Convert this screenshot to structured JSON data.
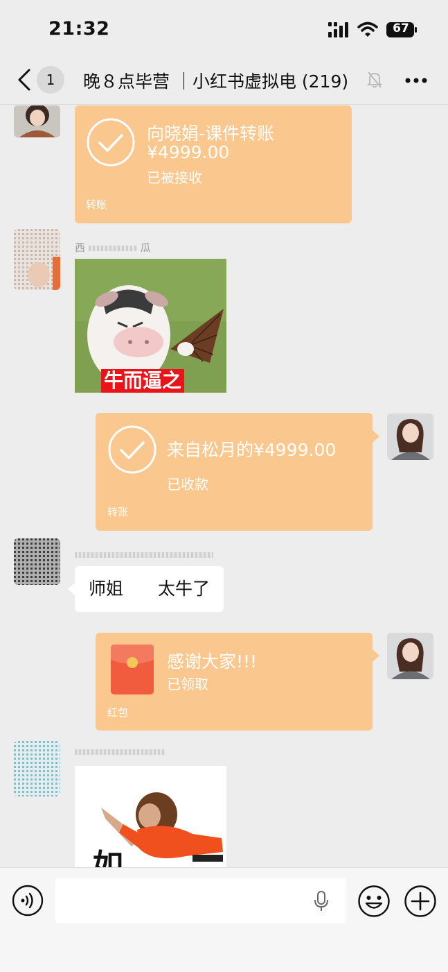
{
  "status_bar": {
    "time": "21:32",
    "battery": "67"
  },
  "nav": {
    "unread_count": "1",
    "title": "晚８点毕营 ｜小红书虚拟电 (219)"
  },
  "messages": [
    {
      "type": "transfer",
      "direction": "incoming",
      "title": "向晓娟-课件转账",
      "amount": "¥4999.00",
      "status": "已被接收",
      "footer": "转账"
    },
    {
      "type": "sticker",
      "direction": "incoming",
      "sender_visible": "西",
      "sender_suffix": "瓜",
      "caption": "牛而逼之"
    },
    {
      "type": "transfer",
      "direction": "outgoing",
      "title": "来自松月的¥4999.00",
      "status": "已收款",
      "footer": "转账"
    },
    {
      "type": "text",
      "direction": "incoming",
      "text": "师姐　　太牛了"
    },
    {
      "type": "red_packet",
      "direction": "outgoing",
      "title": "感谢大家!!!",
      "status": "已领取",
      "footer": "红包"
    },
    {
      "type": "sticker",
      "direction": "incoming",
      "caption_partial": "如"
    }
  ],
  "icons": {
    "back": "chevron-left-icon",
    "mute": "bell-off-icon",
    "more": "more-dots-icon",
    "check": "check-circle-icon",
    "voice": "voice-icon",
    "mic": "microphone-icon",
    "emoji": "emoji-icon",
    "plus": "plus-icon"
  },
  "colors": {
    "bubble_transfer": "#fac88e",
    "background": "#ededed",
    "red_packet": "#f15c3e"
  }
}
